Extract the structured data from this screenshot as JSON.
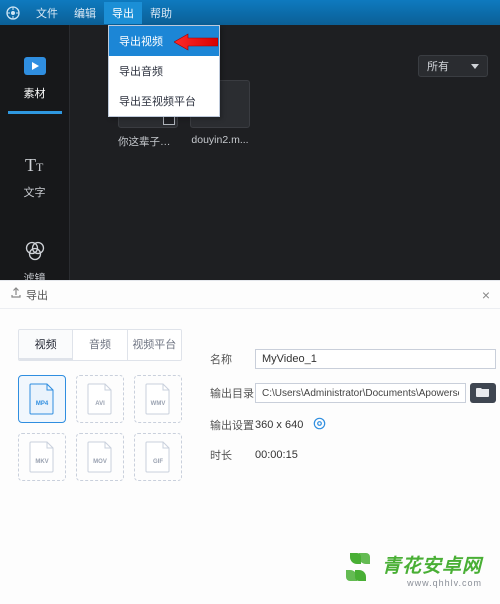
{
  "colors": {
    "accent": "#2f8ee0",
    "brand_green": "#49af35"
  },
  "menu": {
    "items": [
      "文件",
      "编辑",
      "导出",
      "帮助"
    ],
    "active_index": 2
  },
  "dropdown": {
    "items": [
      "导出视频",
      "导出音频",
      "导出至视频平台"
    ],
    "highlight_index": 0
  },
  "sidebar": {
    "items": [
      {
        "label": "素材",
        "icon": "play-icon"
      },
      {
        "label": "文字",
        "icon": "text-icon"
      },
      {
        "label": "滤镜",
        "icon": "filter-icon"
      }
    ],
    "selected_index": 0
  },
  "filter_select": {
    "label": "所有"
  },
  "media": [
    {
      "label": "你这辈子有..."
    },
    {
      "label": "douyin2.m..."
    }
  ],
  "export": {
    "header": "导出",
    "tabs": [
      "视频",
      "音频",
      "视频平台"
    ],
    "active_tab": 0,
    "formats": [
      "MP4",
      "AVI",
      "WMV",
      "MKV",
      "MOV",
      "GIF"
    ],
    "selected_format": 0,
    "form": {
      "name_label": "名称",
      "name_value": "MyVideo_1",
      "path_label": "输出目录",
      "path_value": "C:\\Users\\Administrator\\Documents\\Apowersoft\\Video",
      "res_label": "输出设置",
      "res_value": "360 x 640",
      "dur_label": "时长",
      "dur_value": "00:00:15"
    }
  },
  "watermark": {
    "text": "青花安卓网",
    "sub": "www.qhhlv.com"
  }
}
